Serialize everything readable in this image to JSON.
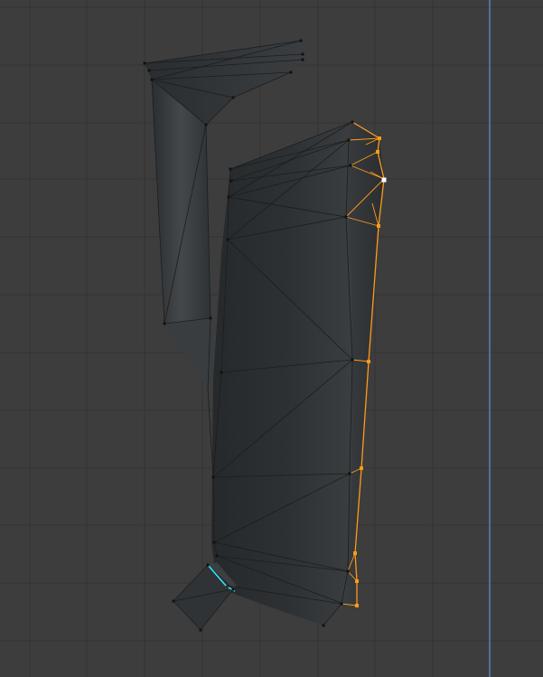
{
  "app": {
    "view": "3d-viewport",
    "mode": "edit-mode"
  },
  "colors": {
    "background": "#3d3d3d",
    "grid_line": "#363636",
    "axis_line": "#5d7fbf",
    "mesh_face_dark": "#242729",
    "mesh_face_mid": "#34383b",
    "mesh_face_light": "#43474a",
    "wire": "#1b1d1f",
    "vertex": "#111111",
    "selection": "#ff9a1a",
    "active_vertex": "#ffffff",
    "seam_highlight": "#2ee4ff"
  },
  "scene": {
    "object": "mesh",
    "selected_edge_loop": "right-side-edge",
    "active_element": "vertex"
  }
}
